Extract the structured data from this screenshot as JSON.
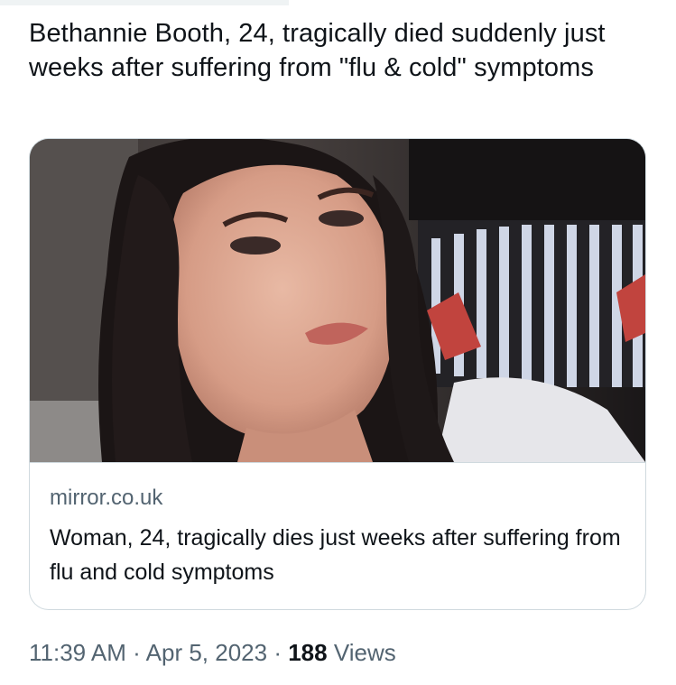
{
  "tweet": {
    "text": "Bethannie Booth, 24, tragically died suddenly just weeks after suffering from \"flu & cold\" symptoms"
  },
  "card": {
    "image": {
      "icon": "photo-of-woman"
    },
    "domain": "mirror.co.uk",
    "title": "Woman, 24, tragically dies just weeks after suffering from flu and cold symptoms"
  },
  "meta": {
    "time": "11:39 AM",
    "separator": "·",
    "date": "Apr 5, 2023",
    "views_count": "188",
    "views_label": "Views"
  },
  "colors": {
    "text_primary": "#0f1419",
    "text_secondary": "#536471",
    "border": "#cfd9de"
  }
}
